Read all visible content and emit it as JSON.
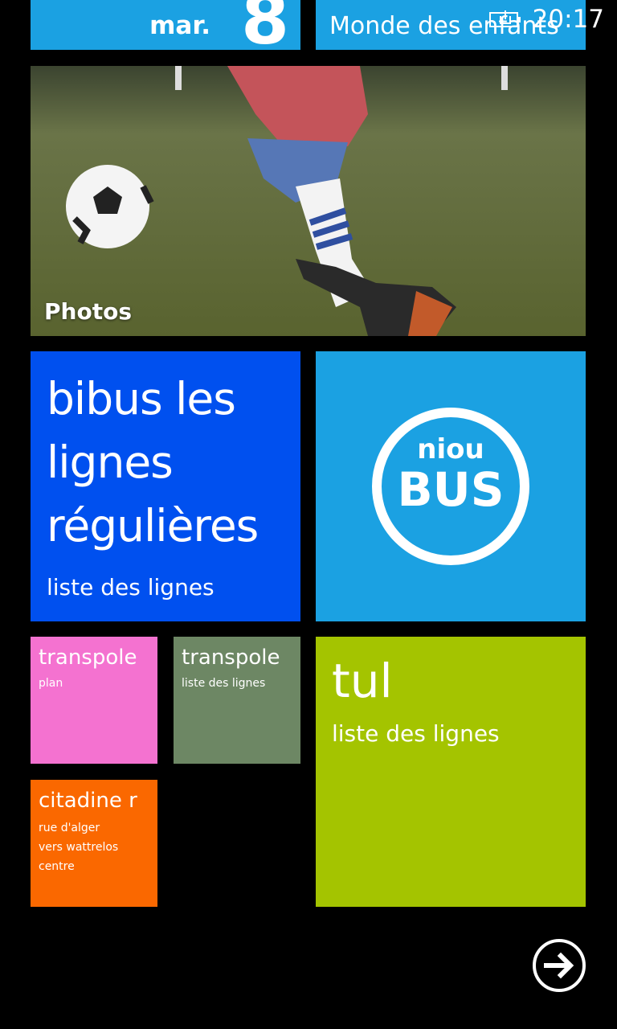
{
  "status_bar": {
    "time": "20:17",
    "battery_icon": "battery-charging-icon"
  },
  "tiles": {
    "calendar": {
      "day": "mar.",
      "date": "8"
    },
    "kids_corner": {
      "label": "Monde des enfants"
    },
    "photos": {
      "label": "Photos"
    },
    "bibus": {
      "title": "bibus les lignes régulières",
      "title_lines": [
        "bibus les",
        "lignes",
        "régulières"
      ],
      "subtitle": "liste des lignes"
    },
    "niou_bus": {
      "logo_top": "niou",
      "logo_bottom": "BUS"
    },
    "transpole_plan": {
      "title": "transpole",
      "subtitle": "plan"
    },
    "transpole_lines": {
      "title": "transpole",
      "subtitle": "liste des lignes"
    },
    "tul": {
      "title": "tul",
      "subtitle": "liste des lignes"
    },
    "citadine": {
      "title": "citadine r",
      "line1": "rue d'alger",
      "line2": "vers wattrelos centre"
    }
  },
  "navigation": {
    "all_apps_icon": "arrow-right-circle-icon"
  },
  "colors": {
    "cyan": "#1ba1e2",
    "cobalt": "#0050ef",
    "pink": "#f472d0",
    "olive": "#6d8764",
    "lime": "#a4c400",
    "orange": "#fa6800",
    "background": "#000000"
  }
}
